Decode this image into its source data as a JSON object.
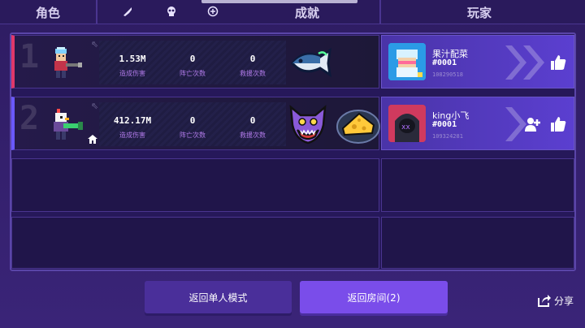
{
  "header": {
    "col_role": "角色",
    "col_achievement": "成就",
    "col_player": "玩家",
    "icons": [
      "dagger-icon",
      "skull-icon",
      "plus-circle-icon"
    ]
  },
  "rows": [
    {
      "rank": "1",
      "damage": "1.53M",
      "damage_label": "造成伤害",
      "deaths": "0",
      "deaths_label": "阵亡次数",
      "rescues": "0",
      "rescues_label": "救援次数",
      "achievements": [
        "fish-badge"
      ],
      "player_name": "果汁配菜",
      "player_tag": "#0001",
      "player_id": "108290518",
      "accent": "#e0386a"
    },
    {
      "rank": "2",
      "damage": "412.17M",
      "damage_label": "造成伤害",
      "deaths": "0",
      "deaths_label": "阵亡次数",
      "rescues": "0",
      "rescues_label": "救援次数",
      "achievements": [
        "wolf-badge",
        "cheese-badge"
      ],
      "player_name": "king小飞",
      "player_tag": "#0001",
      "player_id": "109324281",
      "accent": "#6a58ff"
    }
  ],
  "buttons": {
    "single_mode": "返回单人模式",
    "room": "返回房间(2)",
    "share": "分享"
  }
}
